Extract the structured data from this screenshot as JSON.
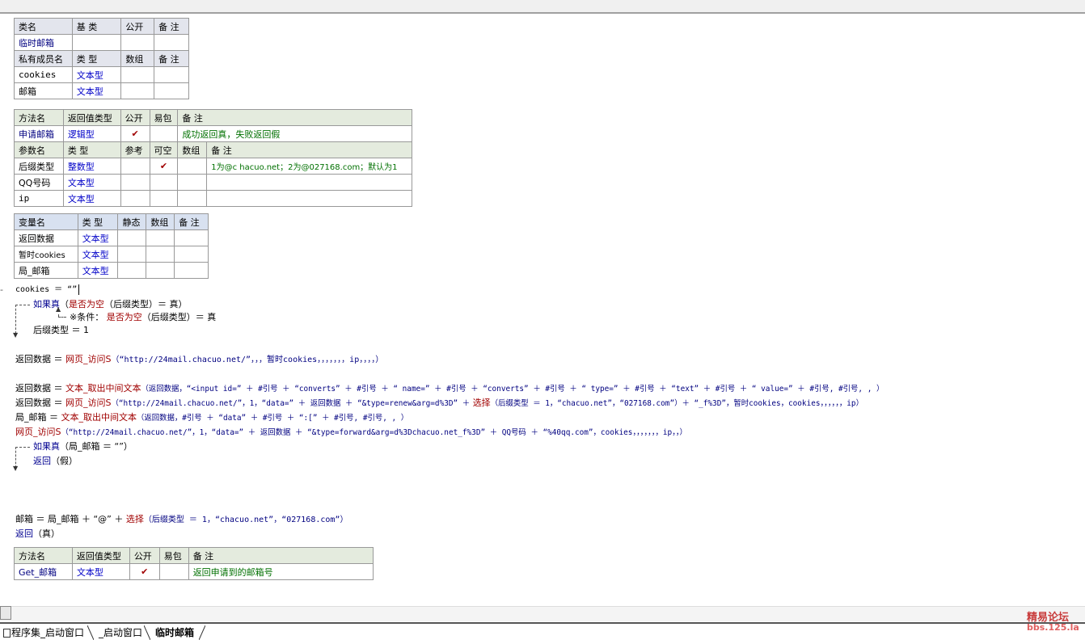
{
  "class_table": {
    "header": [
      "类名",
      "基 类",
      "公开",
      "备 注"
    ],
    "class_name": "临时邮箱",
    "member_header": [
      "私有成员名",
      "类 型",
      "数组",
      "备 注"
    ],
    "members": [
      {
        "name": "cookies",
        "type": "文本型"
      },
      {
        "name": "邮箱",
        "type": "文本型"
      }
    ]
  },
  "method1": {
    "header": [
      "方法名",
      "返回值类型",
      "公开",
      "易包",
      "备 注"
    ],
    "name": "申请邮箱",
    "return_type": "逻辑型",
    "public_mark": "✔",
    "remark": "成功返回真，失败返回假",
    "param_header": [
      "参数名",
      "类 型",
      "参考",
      "可空",
      "数组",
      "备 注"
    ],
    "params": [
      {
        "name": "后缀类型",
        "type": "整数型",
        "nullable_mark": "✔",
        "remark": "1为@c hacuo.net；2为@027168.com；默认为1"
      },
      {
        "name": "QQ号码",
        "type": "文本型",
        "nullable_mark": "",
        "remark": ""
      },
      {
        "name": "ip",
        "type": "文本型",
        "nullable_mark": "",
        "remark": ""
      }
    ]
  },
  "vars": {
    "header": [
      "变量名",
      "类 型",
      "静态",
      "数组",
      "备 注"
    ],
    "rows": [
      {
        "name": "返回数据",
        "type": "文本型"
      },
      {
        "name": "暂时cookies",
        "type": "文本型"
      },
      {
        "name": "局_邮箱",
        "type": "文本型"
      }
    ]
  },
  "code": {
    "l1": "cookies ＝ “”",
    "l2_kw": "如果真",
    "l2_rest_a": "（",
    "l2_fn": "是否为空",
    "l2_rest_b": "（后缀类型）＝ 真）",
    "l3_a": "※条件：",
    "l3_fn": "是否为空",
    "l3_b": "（后缀类型）＝ 真",
    "l4": "后缀类型 ＝ 1",
    "l5_a": "返回数据 ＝",
    "l5_fn": "网页_访问S",
    "l5_b": "（“http://24mail.chacuo.net/”，，，暂时cookies，，，，，，，ip，，，，）",
    "l6_a": "返回数据 ＝",
    "l6_fn": "文本_取出中间文本",
    "l6_b": "（返回数据，“<input id=” ＋ #引号 ＋ “converts” ＋ #引号 ＋ “ name=” ＋ #引号 ＋ “converts” ＋ #引号 ＋ “ type=” ＋ #引号 ＋ “text” ＋ #引号 ＋ “ value=” ＋ #引号, #引号, , ）",
    "l7_a": "返回数据 ＝",
    "l7_fn": "网页_访问S",
    "l7_b": "（“http://24mail.chacuo.net/”，1，“data=” ＋ 返回数据 ＋ “&type=renew&arg=d%3D” ＋",
    "l7_fn2": "选择",
    "l7_c": "（后缀类型 ＝ 1，“chacuo.net”，“027168.com”）＋ “_f%3D”，暂时cookies，cookies，，，，，，ip）",
    "l8_a": "局_邮箱 ＝",
    "l8_fn": "文本_取出中间文本",
    "l8_b": "（返回数据，#引号 ＋ “data” ＋ #引号 ＋ “:[” ＋ #引号, #引号, , ）",
    "l9_fn": "网页_访问S",
    "l9_b": "（“http://24mail.chacuo.net/”，1，“data=” ＋ 返回数据 ＋ “&type=forward&arg=d%3Dchacuo.net_f%3D” ＋ QQ号码 ＋ “%40qq.com”，cookies，，，，，，，ip，，）",
    "l10_kw": "如果真",
    "l10_b": "（局_邮箱 ＝ “”）",
    "l11_kw": "返回",
    "l11_b": "（假）",
    "l12_a": "邮箱 ＝ 局_邮箱 ＋ “@” ＋",
    "l12_fn": "选择",
    "l12_b": "（后缀类型 ＝ 1，“chacuo.net”，“027168.com”）",
    "l13_kw": "返回",
    "l13_b": "（真）"
  },
  "method2": {
    "header": [
      "方法名",
      "返回值类型",
      "公开",
      "易包",
      "备 注"
    ],
    "name": "Get_邮箱",
    "return_type": "文本型",
    "public_mark": "✔",
    "remark": "返回申请到的邮箱号"
  },
  "tabs": [
    "程序集_启动窗口",
    "_启动窗口",
    "临时邮箱"
  ],
  "tab_icon": "module-icon",
  "watermark": {
    "line1": "精易论坛",
    "line2": "bbs.125.la"
  }
}
